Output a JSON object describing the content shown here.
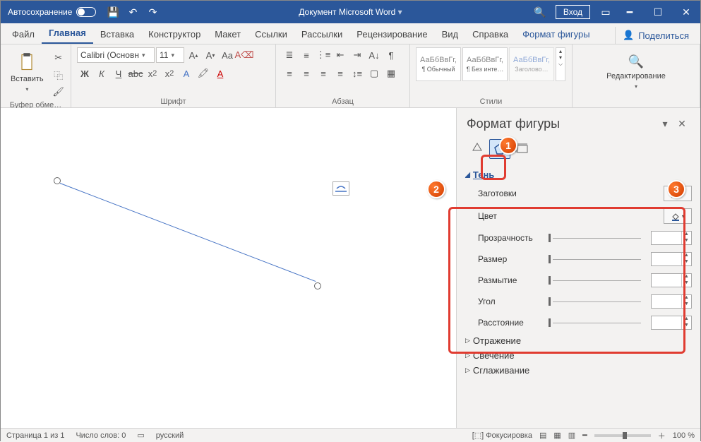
{
  "titlebar": {
    "autosave": "Автосохранение",
    "doctitle": "Документ Microsoft Word",
    "login": "Вход"
  },
  "tabs": {
    "file": "Файл",
    "home": "Главная",
    "insert": "Вставка",
    "design": "Конструктор",
    "layout": "Макет",
    "references": "Ссылки",
    "mailings": "Рассылки",
    "review": "Рецензирование",
    "view": "Вид",
    "help": "Справка",
    "format": "Формат фигуры",
    "share": "Поделиться"
  },
  "ribbon": {
    "clipboard": {
      "paste": "Вставить",
      "label": "Буфер обме…"
    },
    "font": {
      "name": "Calibri (Основн",
      "size": "11",
      "label": "Шрифт"
    },
    "paragraph": {
      "label": "Абзац"
    },
    "styles": {
      "preview": "АаБбВвГг,",
      "s1": "¶ Обычный",
      "s2": "¶ Без инте…",
      "s3": "Заголово…",
      "label": "Стили"
    },
    "editing": {
      "label": "Редактирование"
    }
  },
  "panel": {
    "title": "Формат фигуры",
    "shadow": "Тень",
    "presets": "Заготовки",
    "color": "Цвет",
    "transparency": "Прозрачность",
    "size": "Размер",
    "blur": "Размытие",
    "angle": "Угол",
    "distance": "Расстояние",
    "reflection": "Отражение",
    "glow": "Свечение",
    "soft": "Сглаживание"
  },
  "statusbar": {
    "page": "Страница 1 из 1",
    "words": "Число слов: 0",
    "lang": "русский",
    "focus": "Фокусировка",
    "zoom": "100 %"
  },
  "callouts": {
    "c1": "1",
    "c2": "2",
    "c3": "3"
  }
}
